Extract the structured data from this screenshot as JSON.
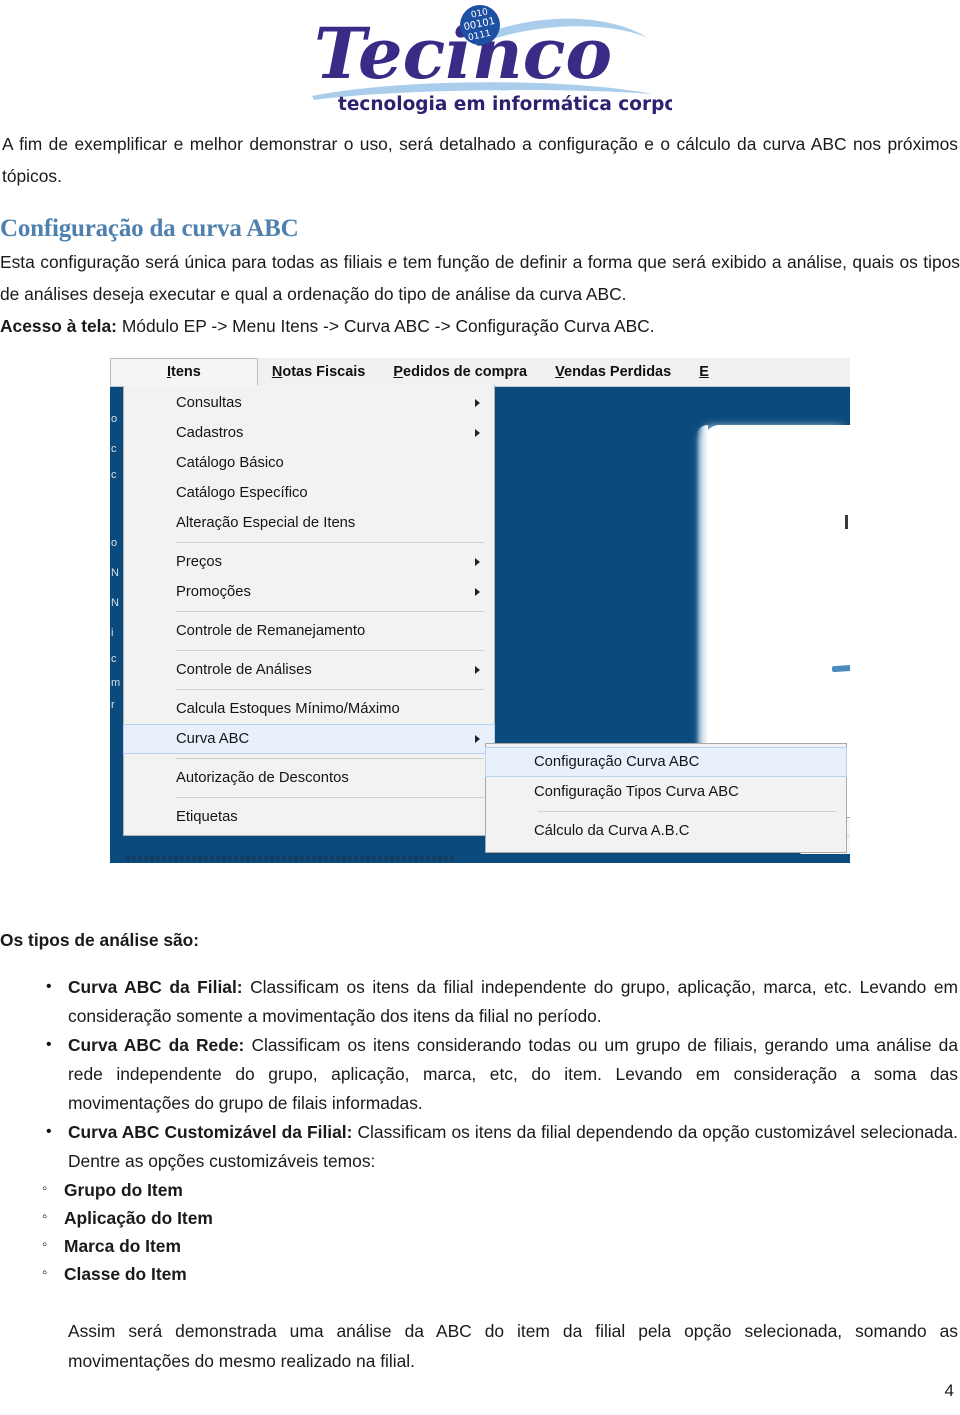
{
  "logo": {
    "wordmark": "Tecinco",
    "tagline": "tecnologia em informática corporativa",
    "badge_lines": [
      "010",
      "00101",
      "0111"
    ],
    "wordmark_color": "#3b2a86",
    "tagline_color": "#2d2170",
    "badge_color": "#1d4fa3",
    "swoosh_color": "#a9cdea"
  },
  "doc": {
    "intro": "A fim de exemplificar e melhor demonstrar o uso, será detalhado a configuração e o cálculo da curva ABC nos próximos tópicos.",
    "heading": "Configuração da curva ABC",
    "heading_color": "#4f81ae",
    "heading_paragraph": "Esta configuração será única para todas as filiais e tem função de definir a forma que será exibido a análise, quais os tipos de análises deseja executar e qual a ordenação do tipo de análise da curva ABC.",
    "acesso_label": "Acesso à tela:",
    "acesso_path": "Módulo EP -> Menu Itens -> Curva ABC -> Configuração Curva ABC."
  },
  "screenshot": {
    "desktop_color": "#0a4a7d",
    "menubar": [
      {
        "label": "Itens",
        "accel": "I",
        "active": true
      },
      {
        "label": "Notas Fiscais",
        "accel": "N",
        "active": false
      },
      {
        "label": "Pedidos de compra",
        "accel": "P",
        "active": false
      },
      {
        "label": "Vendas Perdidas",
        "accel": "V",
        "active": false
      },
      {
        "label": "E",
        "accel": "E",
        "active": false
      }
    ],
    "itens_menu": [
      {
        "label": "Consultas",
        "submenu": true,
        "sep_after": false
      },
      {
        "label": "Cadastros",
        "submenu": true,
        "sep_after": false
      },
      {
        "label": "Catálogo Básico",
        "submenu": false,
        "sep_after": false
      },
      {
        "label": "Catálogo Específico",
        "submenu": false,
        "sep_after": false
      },
      {
        "label": "Alteração Especial de Itens",
        "submenu": false,
        "sep_after": true
      },
      {
        "label": "Preços",
        "submenu": true,
        "sep_after": false
      },
      {
        "label": "Promoções",
        "submenu": true,
        "sep_after": true
      },
      {
        "label": "Controle de Remanejamento",
        "submenu": false,
        "sep_after": true
      },
      {
        "label": "Controle de Análises",
        "submenu": true,
        "sep_after": true
      },
      {
        "label": "Calcula Estoques Mínimo/Máximo",
        "submenu": false,
        "sep_after": false
      },
      {
        "label": "Curva ABC",
        "submenu": true,
        "sep_after": true,
        "highlighted": true
      },
      {
        "label": "Autorização de Descontos",
        "submenu": false,
        "sep_after": true
      },
      {
        "label": "Etiquetas",
        "submenu": false,
        "sep_after": false
      }
    ],
    "curva_abc_submenu": [
      {
        "label": "Configuração Curva ABC",
        "highlighted": true,
        "sep_after": false
      },
      {
        "label": "Configuração Tipos Curva ABC",
        "highlighted": false,
        "sep_after": true
      },
      {
        "label": "Cálculo da Curva A.B.C",
        "highlighted": false,
        "sep_after": false
      }
    ]
  },
  "lists": {
    "lead": "Os tipos de análise são:",
    "bullets": [
      {
        "term": "Curva ABC da Filial:",
        "text": " Classificam os itens da filial independente do grupo, aplicação, marca, etc. Levando em consideração somente a movimentação dos itens da filial no período."
      },
      {
        "term": "Curva ABC da Rede:",
        "text": " Classificam os itens considerando todas ou um grupo de filiais, gerando uma análise da rede independente do grupo, aplicação, marca, etc, do item. Levando em consideração a soma das movimentações do grupo de filais informadas."
      },
      {
        "term": "Curva ABC Customizável da Filial:",
        "text": " Classificam os itens da filial dependendo da opção customizável selecionada. Dentre as opções customizáveis temos:"
      }
    ],
    "subbullets": [
      "Grupo do Item",
      "Aplicação do Item",
      "Marca do Item",
      "Classe do Item"
    ],
    "closing": "Assim será demonstrada uma análise da ABC do item da filial pela opção selecionada, somando as movimentações do mesmo realizado na filial."
  },
  "footer": {
    "page_number": "4"
  }
}
